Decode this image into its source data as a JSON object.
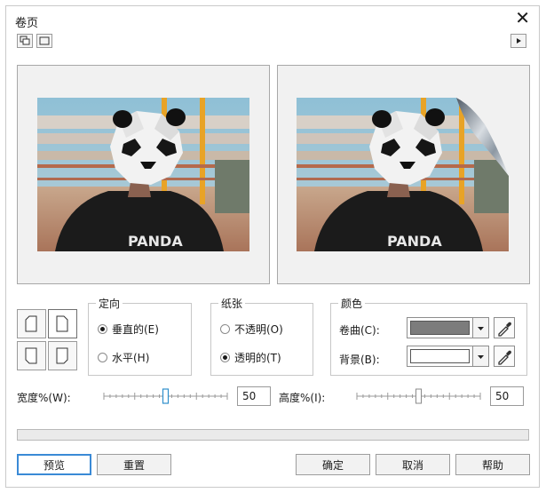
{
  "window": {
    "title": "卷页"
  },
  "orientation": {
    "title": "定向",
    "vertical_label": "垂直的(E)",
    "horizontal_label": "水平(H)",
    "selected": "vertical"
  },
  "paper": {
    "title": "纸张",
    "opaque_label": "不透明(O)",
    "transparent_label": "透明的(T)",
    "selected": "transparent"
  },
  "color": {
    "title": "颜色",
    "curl_label": "卷曲(C):",
    "background_label": "背景(B):",
    "curl_color": "#7c7c7c",
    "background_color": "#ffffff"
  },
  "width": {
    "label": "宽度%(W):",
    "value": "50",
    "level": 0.5
  },
  "height": {
    "label": "高度%(I):",
    "value": "50",
    "level": 0.5
  },
  "progress": {
    "level": 0
  },
  "buttons": {
    "preview": "预览",
    "reset": "重置",
    "ok": "确定",
    "cancel": "取消",
    "help": "帮助"
  },
  "photo_text": "PANDA",
  "colors": {
    "accent": "#3a8ad6",
    "slider_thumb": "#2f8fcc"
  }
}
